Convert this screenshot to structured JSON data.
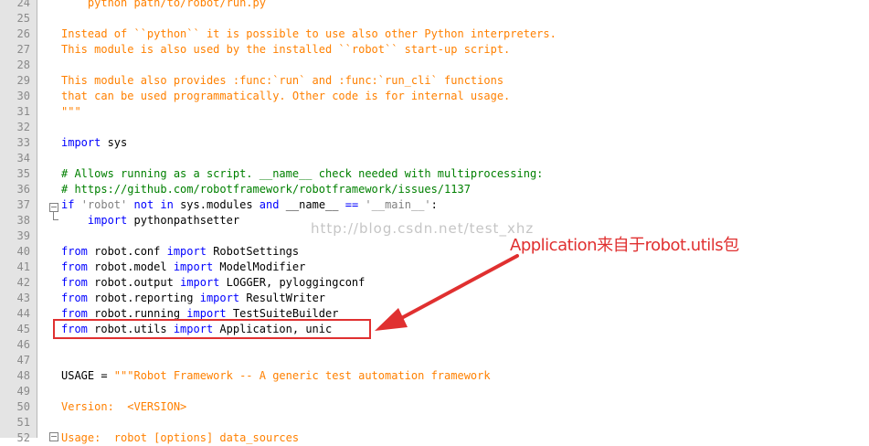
{
  "editor": {
    "lines": [
      {
        "n": "24",
        "segs": [
          [
            "",
            "    python path/to/robot/run.py",
            "ds"
          ]
        ]
      },
      {
        "n": "25",
        "segs": []
      },
      {
        "n": "26",
        "segs": [
          [
            "",
            "Instead of ``python`` it is possible to use also other Python interpreters.",
            "ds"
          ]
        ]
      },
      {
        "n": "27",
        "segs": [
          [
            "",
            "This module is also used by the installed ``robot`` start-up script.",
            "ds"
          ]
        ]
      },
      {
        "n": "28",
        "segs": []
      },
      {
        "n": "29",
        "segs": [
          [
            "",
            "This module also provides :func:`run` and :func:`run_cli` functions",
            "ds"
          ]
        ]
      },
      {
        "n": "30",
        "segs": [
          [
            "",
            "that can be used programmatically. Other code is for internal usage.",
            "ds"
          ]
        ]
      },
      {
        "n": "31",
        "segs": [
          [
            "",
            "\"\"\"",
            "ds"
          ]
        ]
      },
      {
        "n": "32",
        "segs": []
      },
      {
        "n": "33",
        "segs": [
          [
            "",
            "import",
            "kw"
          ],
          [
            "",
            " sys",
            ""
          ]
        ]
      },
      {
        "n": "34",
        "segs": []
      },
      {
        "n": "35",
        "segs": [
          [
            "",
            "# Allows running as a script. __name__ check needed with multiprocessing:",
            "cm"
          ]
        ]
      },
      {
        "n": "36",
        "segs": [
          [
            "",
            "# https://github.com/robotframework/robotframework/issues/1137",
            "cm"
          ]
        ]
      },
      {
        "n": "37",
        "segs": [
          [
            "",
            "if",
            "kw"
          ],
          [
            "",
            " ",
            ""
          ],
          [
            "",
            "'robot'",
            "st"
          ],
          [
            "",
            " ",
            ""
          ],
          [
            "",
            "not in",
            "kw"
          ],
          [
            "",
            " sys.modules ",
            ""
          ],
          [
            "",
            "and",
            "kw"
          ],
          [
            "",
            " __name__ ",
            ""
          ],
          [
            "",
            "==",
            "kw"
          ],
          [
            "",
            " ",
            ""
          ],
          [
            "",
            "'__main__'",
            "st"
          ],
          [
            "",
            ":",
            ""
          ]
        ]
      },
      {
        "n": "38",
        "segs": [
          [
            "",
            "    ",
            ""
          ],
          [
            "",
            "import",
            "kw"
          ],
          [
            "",
            " pythonpathsetter",
            ""
          ]
        ]
      },
      {
        "n": "39",
        "segs": []
      },
      {
        "n": "40",
        "segs": [
          [
            "",
            "from",
            "kw"
          ],
          [
            "",
            " robot.conf ",
            ""
          ],
          [
            "",
            "import",
            "kw"
          ],
          [
            "",
            " RobotSettings",
            ""
          ]
        ]
      },
      {
        "n": "41",
        "segs": [
          [
            "",
            "from",
            "kw"
          ],
          [
            "",
            " robot.model ",
            ""
          ],
          [
            "",
            "import",
            "kw"
          ],
          [
            "",
            " ModelModifier",
            ""
          ]
        ]
      },
      {
        "n": "42",
        "segs": [
          [
            "",
            "from",
            "kw"
          ],
          [
            "",
            " robot.output ",
            ""
          ],
          [
            "",
            "import",
            "kw"
          ],
          [
            "",
            " LOGGER, pyloggingconf",
            ""
          ]
        ]
      },
      {
        "n": "43",
        "segs": [
          [
            "",
            "from",
            "kw"
          ],
          [
            "",
            " robot.reporting ",
            ""
          ],
          [
            "",
            "import",
            "kw"
          ],
          [
            "",
            " ResultWriter",
            ""
          ]
        ]
      },
      {
        "n": "44",
        "segs": [
          [
            "",
            "from",
            "kw"
          ],
          [
            "",
            " robot.running ",
            ""
          ],
          [
            "",
            "import",
            "kw"
          ],
          [
            "",
            " TestSuiteBuilder",
            ""
          ]
        ]
      },
      {
        "n": "45",
        "segs": [
          [
            "",
            "from",
            "kw"
          ],
          [
            "",
            " robot.utils ",
            ""
          ],
          [
            "",
            "import",
            "kw"
          ],
          [
            "",
            " Application, unic",
            ""
          ]
        ]
      },
      {
        "n": "46",
        "segs": []
      },
      {
        "n": "47",
        "segs": []
      },
      {
        "n": "48",
        "segs": [
          [
            "",
            "USAGE = ",
            ""
          ],
          [
            "",
            "\"\"\"Robot Framework -- A generic test automation framework",
            "ds"
          ]
        ]
      },
      {
        "n": "49",
        "segs": []
      },
      {
        "n": "50",
        "segs": [
          [
            "",
            "Version:  <VERSION>",
            "ds"
          ]
        ]
      },
      {
        "n": "51",
        "segs": []
      },
      {
        "n": "52",
        "segs": [
          [
            "",
            "Usage:  robot [options] data_sources",
            "ds"
          ]
        ]
      }
    ]
  },
  "watermark": "http://blog.csdn.net/test_xhz",
  "annotation": "Application来自于robot.utils包",
  "colors": {
    "keyword": "#0000ff",
    "comment": "#008000",
    "docstring": "#ff8000",
    "string": "#808080",
    "annotation": "#e03030"
  }
}
